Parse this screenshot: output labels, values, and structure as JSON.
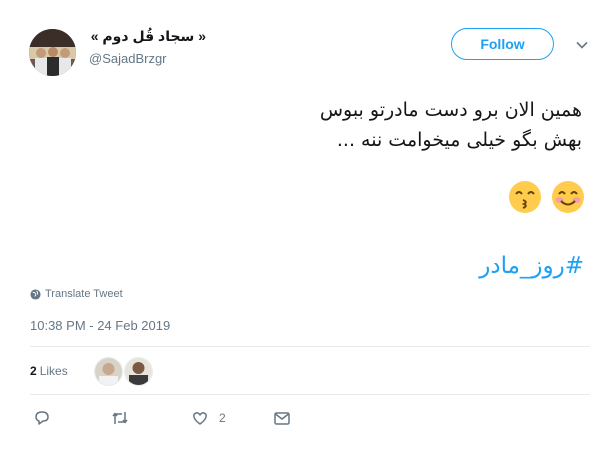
{
  "user": {
    "display_name": "« سجاد قُل دوم »",
    "handle": "@SajadBrzgr"
  },
  "follow_button": {
    "label": "Follow"
  },
  "tweet": {
    "text": "همین الان برو دست مادرتو ببوس\nبهش بگو خیلی میخوامت ننه ...",
    "emojis": [
      "smiling-face-with-smiling-eyes",
      "kissing-face-with-smiling-eyes"
    ],
    "hashtag": "#روز_مادر"
  },
  "translate": {
    "label": "Translate Tweet"
  },
  "timestamp": "10:38 PM - 24 Feb 2019",
  "engagement": {
    "likes_count": "2",
    "likes_label": "Likes"
  },
  "actions": {
    "like_count": "2"
  },
  "colors": {
    "accent": "#1da1f2",
    "muted": "#657786",
    "text": "#14171a"
  }
}
